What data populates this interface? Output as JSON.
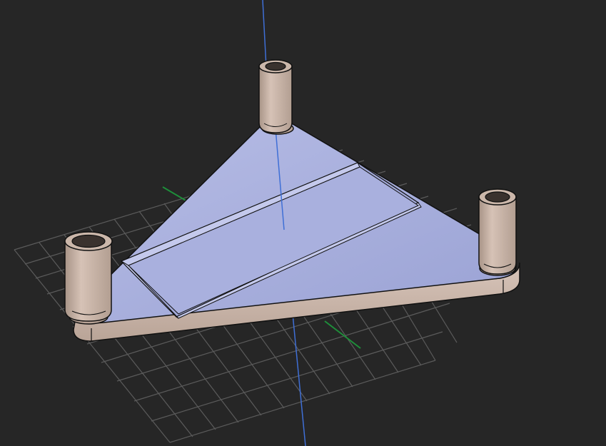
{
  "viewport": {
    "background": "#262626",
    "grid_color": "#5b5b5b",
    "axis_z_color": "#3f6fd6",
    "axis_y_color": "#1e8f3a"
  },
  "model": {
    "plate_top_color": "#a8afdc",
    "plate_side_color": "#c9b4a8",
    "post_color": "#c8b3a6",
    "outline_color": "#111111"
  }
}
